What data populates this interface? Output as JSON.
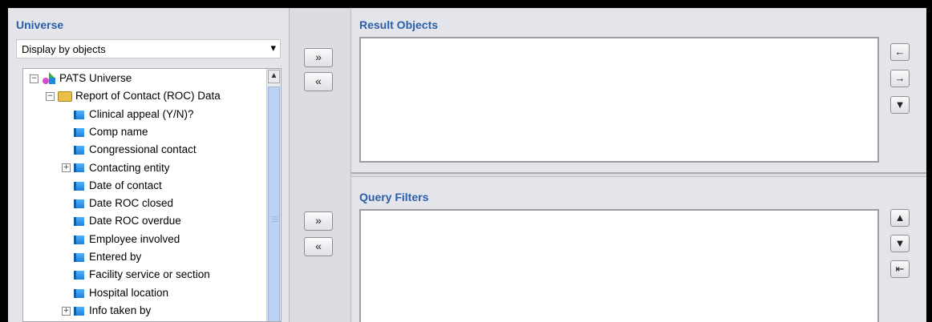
{
  "universe": {
    "title": "Universe",
    "display_mode": "Display by objects",
    "tree": [
      {
        "label": "PATS Universe",
        "level": 0,
        "expander": "−",
        "icon": "universe-icon"
      },
      {
        "label": "Report of Contact (ROC) Data",
        "level": 1,
        "expander": "−",
        "icon": "folder-icon"
      },
      {
        "label": "Clinical appeal (Y/N)?",
        "level": 2,
        "expander": "",
        "icon": "object-icon"
      },
      {
        "label": "Comp name",
        "level": 2,
        "expander": "",
        "icon": "object-icon"
      },
      {
        "label": "Congressional contact",
        "level": 2,
        "expander": "",
        "icon": "object-icon"
      },
      {
        "label": "Contacting entity",
        "level": 2,
        "expander": "+",
        "icon": "object-icon"
      },
      {
        "label": "Date of contact",
        "level": 2,
        "expander": "",
        "icon": "object-icon"
      },
      {
        "label": "Date ROC closed",
        "level": 2,
        "expander": "",
        "icon": "object-icon"
      },
      {
        "label": "Date ROC overdue",
        "level": 2,
        "expander": "",
        "icon": "object-icon"
      },
      {
        "label": "Employee involved",
        "level": 2,
        "expander": "",
        "icon": "object-icon"
      },
      {
        "label": "Entered by",
        "level": 2,
        "expander": "",
        "icon": "object-icon"
      },
      {
        "label": "Facility service or section",
        "level": 2,
        "expander": "",
        "icon": "object-icon"
      },
      {
        "label": "Hospital location",
        "level": 2,
        "expander": "",
        "icon": "object-icon"
      },
      {
        "label": "Info taken by",
        "level": 2,
        "expander": "+",
        "icon": "object-icon"
      }
    ]
  },
  "transfer": {
    "add_label": "»",
    "remove_label": "«"
  },
  "result_objects": {
    "title": "Result Objects",
    "buttons": [
      "←",
      "→",
      "▼"
    ]
  },
  "query_filters": {
    "title": "Query Filters",
    "buttons": [
      "▲",
      "▼",
      "⇤"
    ]
  }
}
